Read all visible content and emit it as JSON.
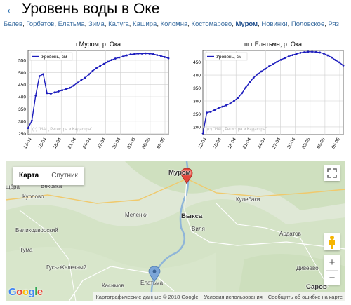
{
  "header": {
    "back_arrow": "←",
    "title": "Уровень воды в Оке"
  },
  "cities": [
    "Белев",
    "Горбатов",
    "Елатьма",
    "Зима",
    "Калуга",
    "Кашира",
    "Коломна",
    "Костомарово",
    "Муром",
    "Новинки",
    "Половское",
    "Ряз"
  ],
  "active_city": "Муром",
  "chart_data": [
    {
      "type": "line",
      "title": "г.Муром, р. Ока",
      "series": [
        {
          "name": "Уровень, см",
          "color": "#1c1cbd",
          "values": [
            272,
            302,
            405,
            485,
            493,
            415,
            413,
            418,
            422,
            427,
            431,
            437,
            446,
            458,
            468,
            478,
            492,
            506,
            517,
            527,
            535,
            544,
            551,
            557,
            561,
            565,
            570,
            574,
            575,
            577,
            577,
            578,
            577,
            575,
            571,
            568,
            563,
            558
          ]
        }
      ],
      "x": [
        "12-04",
        "15-04",
        "18-04",
        "21-04",
        "24-04",
        "27-04",
        "30-04",
        "03-05",
        "06-05",
        "09-05"
      ],
      "yticks": [
        250,
        300,
        350,
        400,
        450,
        500,
        550
      ],
      "ylim": [
        245,
        590
      ],
      "watermark": "(с) \"ИАЦ Регистра и Кадастра\"",
      "grid": true,
      "legend": "top-left"
    },
    {
      "type": "line",
      "title": "пгт Елатьма, р. Ока",
      "series": [
        {
          "name": "Уровень, см",
          "color": "#1c1cbd",
          "values": [
            175,
            255,
            258,
            265,
            272,
            278,
            283,
            290,
            300,
            312,
            330,
            352,
            372,
            390,
            403,
            414,
            424,
            434,
            442,
            451,
            459,
            466,
            472,
            477,
            482,
            486,
            488,
            490,
            490,
            489,
            487,
            483,
            476,
            468,
            458,
            449,
            437
          ]
        }
      ],
      "x": [
        "12-04",
        "15-04",
        "18-04",
        "21-04",
        "24-04",
        "27-04",
        "30-04",
        "03-05",
        "06-05",
        "09-05"
      ],
      "yticks": [
        200,
        250,
        300,
        350,
        400,
        450
      ],
      "ylim": [
        170,
        495
      ],
      "watermark": "(с) \"ИАЦ Регистра и Кадастра\"",
      "grid": true,
      "legend": "top-left"
    }
  ],
  "map": {
    "type_map": "Карта",
    "type_satellite": "Спутник",
    "zoom_in": "+",
    "zoom_out": "−",
    "google": "Google",
    "footer_copyright": "Картографические данные © 2018 Google",
    "footer_terms": "Условия использования",
    "footer_report": "Сообщить об ошибке на карте",
    "labels": {
      "murom": "Муром",
      "vyksa": "Выкса",
      "elatma": "Елатьма",
      "sarov": "Саров",
      "gus": "Гусь-Железный",
      "kasimov": "Касимов",
      "vekovka": "Вековка",
      "kurlovo": "Курлово",
      "velikodvorsky": "Великодворский",
      "tuma": "Тума",
      "meleнки": "Меленки",
      "kulebaki": "Кулебаки",
      "vilya": "Виля",
      "ardatov": "Ардатов",
      "diveevo": "Дивеево",
      "shchyora": "щёра"
    }
  }
}
